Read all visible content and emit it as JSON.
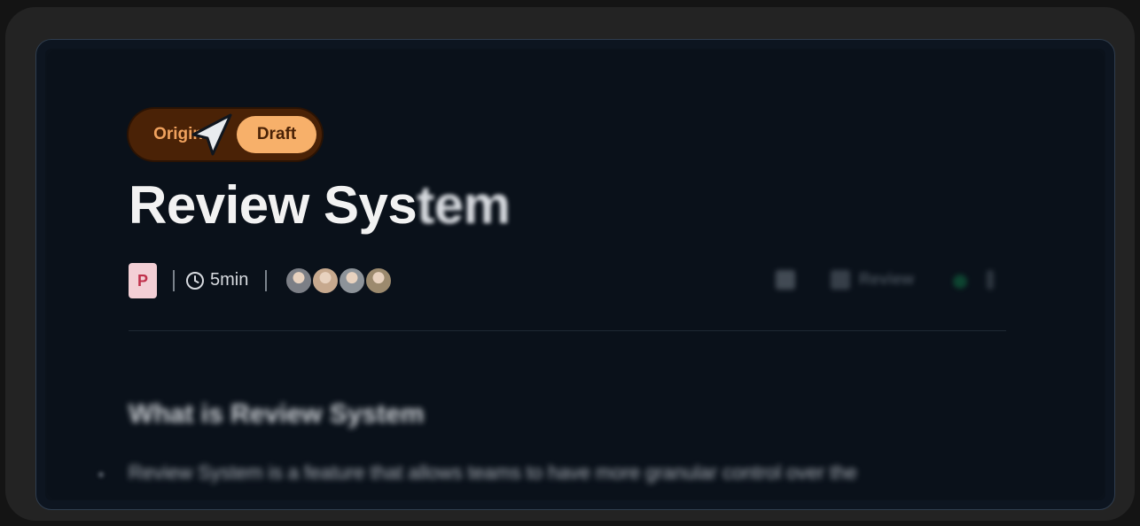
{
  "toggle": {
    "options": [
      "Original",
      "Draft"
    ],
    "selected": "Draft"
  },
  "page": {
    "title_sharp": "Review Sys",
    "title_blurred": "tem"
  },
  "meta": {
    "doc_badge": "P",
    "duration": "5min",
    "avatar_colors": [
      "#7c7f86",
      "#c7a98e",
      "#8d9399",
      "#9c8a6e"
    ]
  },
  "tools": {
    "review_label": "Review"
  },
  "content": {
    "heading": "What is Review System",
    "paragraph": "Review System is a feature that allows teams to have more granular control over the"
  },
  "colors": {
    "toggle_bg": "#4a2206",
    "toggle_active": "#f7b06a",
    "toggle_text": "#f0a25e",
    "background": "#0a111a",
    "badge_bg": "#f3cfd5",
    "badge_text": "#c0314b"
  }
}
